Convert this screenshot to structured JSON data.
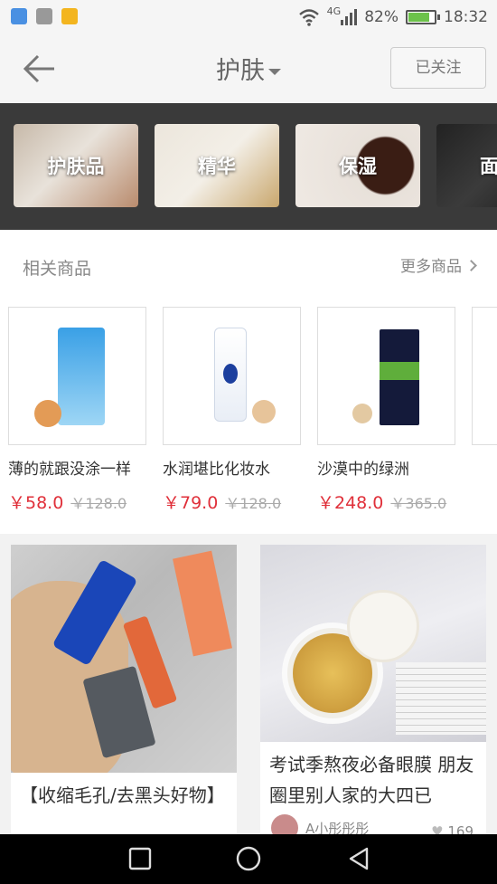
{
  "status": {
    "network": "4G",
    "battery": "82%",
    "battery_level": 0.82,
    "time": "18:32"
  },
  "header": {
    "title": "护肤",
    "follow_label": "已关注"
  },
  "categories": [
    {
      "label": "护肤品"
    },
    {
      "label": "精华"
    },
    {
      "label": "保湿"
    },
    {
      "label": "面"
    }
  ],
  "related": {
    "title": "相关商品",
    "more_label": "更多商品",
    "products": [
      {
        "name": "薄的就跟没涂一样",
        "price": "￥58.0",
        "orig": "￥128.0"
      },
      {
        "name": "水润堪比化妆水",
        "price": "￥79.0",
        "orig": "￥128.0"
      },
      {
        "name": "沙漠中的绿洲",
        "price": "￥248.0",
        "orig": "￥365.0"
      }
    ]
  },
  "feed": [
    {
      "caption": "【收缩毛孔/去黑头好物】"
    },
    {
      "caption": "考试季熬夜必备眼膜 朋友圈里别人家的大四已",
      "author": "A小彤彤彤",
      "likes": "169"
    }
  ],
  "colors": {
    "price_red": "#e0303a",
    "category_bar": "#3a3a3a",
    "battery_green": "#6cc24a"
  }
}
